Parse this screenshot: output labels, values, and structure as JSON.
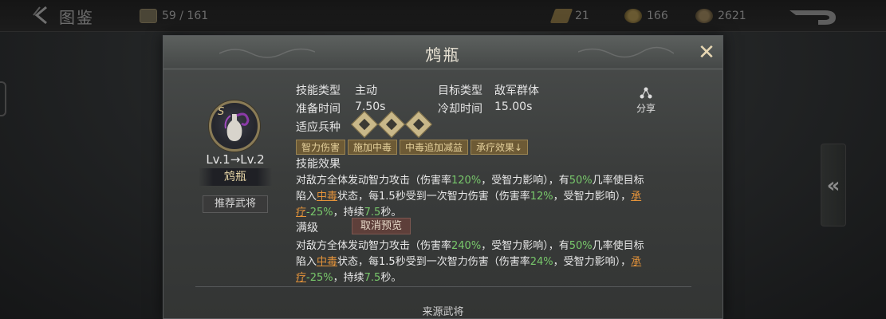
{
  "topbar": {
    "title": "图鉴",
    "collection_count": "59 / 161",
    "resources": [
      {
        "name": "token",
        "value": "21"
      },
      {
        "name": "copper",
        "value": "166"
      },
      {
        "name": "gem",
        "value": "2621"
      }
    ]
  },
  "modal": {
    "title": "鸩瓶",
    "skill": {
      "letter": "S",
      "level": "Lv.1→Lv.2",
      "name": "鸩瓶",
      "recommend_label": "推荐武将"
    },
    "info": {
      "skill_type_label": "技能类型",
      "skill_type_value": "主动",
      "target_type_label": "目标类型",
      "target_type_value": "敌军群体",
      "prepare_label": "准备时间",
      "prepare_value": "7.50s",
      "cooldown_label": "冷却时间",
      "cooldown_value": "15.00s",
      "troops_label": "适应兵种",
      "troops": [
        "spear-troop-icon",
        "cavalry-troop-icon",
        "archer-troop-icon"
      ]
    },
    "share_label": "分享",
    "tags": [
      "智力伤害",
      "施加中毒",
      "中毒追加减益",
      "承疗效果↓"
    ],
    "effect_label": "技能效果",
    "effect": {
      "line1_a": "对敌方全体发动智力攻击（伤害率",
      "line1_pct": "120%",
      "line1_b": "，受智力影响），有",
      "line1_chance": "50%",
      "line1_c": "几率使目标",
      "line2_a": "陷入",
      "line2_poison": "中毒",
      "line2_b": "状态，每1.5秒受到一次智力伤害（伤害率",
      "line2_pct": "12%",
      "line2_c": "，受智力影响），",
      "line2_heal": "承",
      "line3_heal": "疗",
      "line3_pct": "-25%",
      "line3_b": "，持续",
      "line3_dur": "7.5",
      "line3_c": "秒。"
    },
    "max_label": "满级",
    "cancel_preview_label": "取消预览",
    "max_effect": {
      "line1_a": "对敌方全体发动智力攻击（伤害率",
      "line1_pct": "240%",
      "line1_b": "，受智力影响），有",
      "line1_chance": "50%",
      "line1_c": "几率使目标",
      "line2_a": "陷入",
      "line2_poison": "中毒",
      "line2_b": "状态，每1.5秒受到一次智力伤害（伤害率",
      "line2_pct": "24%",
      "line2_c": "，受智力影响），",
      "line2_heal": "承",
      "line3_heal": "疗",
      "line3_pct": "-25%",
      "line3_b": "，持续",
      "line3_dur": "7.5",
      "line3_c": "秒。"
    },
    "source_label": "来源武将"
  },
  "colors": {
    "highlight_green": "#78c86b",
    "highlight_orange": "#e4933a",
    "tag_gold": "#e3cf9a"
  }
}
